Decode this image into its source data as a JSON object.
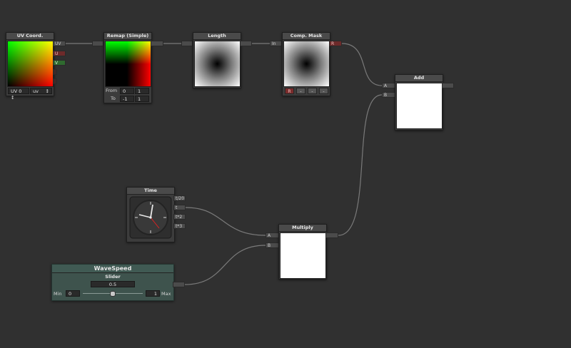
{
  "nodes": {
    "uv": {
      "title": "UV Coord.",
      "outputs": [
        "UV",
        "U",
        "V",
        "",
        ""
      ],
      "uv_select": "UV 0",
      "uv_channel": "uv",
      "arrow": "↕"
    },
    "remap": {
      "title": "Remap (Simple)",
      "from_label": "From",
      "from_min": "0",
      "from_max": "1",
      "to_label": "To",
      "to_min": "-1",
      "to_max": "1"
    },
    "length": {
      "title": "Length"
    },
    "mask": {
      "title": "Comp. Mask",
      "input": "In",
      "output": "R",
      "channels": [
        "R",
        "-",
        "-",
        "-"
      ]
    },
    "add": {
      "title": "Add",
      "inputs": [
        "A",
        "B"
      ]
    },
    "time": {
      "title": "Time",
      "outputs": [
        "t/20",
        "t",
        "t*2",
        "t*3"
      ]
    },
    "multiply": {
      "title": "Multiply",
      "inputs": [
        "A",
        "B"
      ]
    },
    "wavespeed": {
      "title": "WaveSpeed",
      "subtitle": "Slider",
      "value": "0.5",
      "min_label": "Min",
      "min": "0",
      "max": "1",
      "max_label": "Max",
      "slider_position": 0.5
    }
  },
  "colors": {
    "background": "#303030",
    "node": "#3c3c3c",
    "wire": "#7a7a7a",
    "port_red": "#6d2a2a",
    "port_green": "#2f6a2f",
    "wavespeed_node": "#3e534d"
  }
}
